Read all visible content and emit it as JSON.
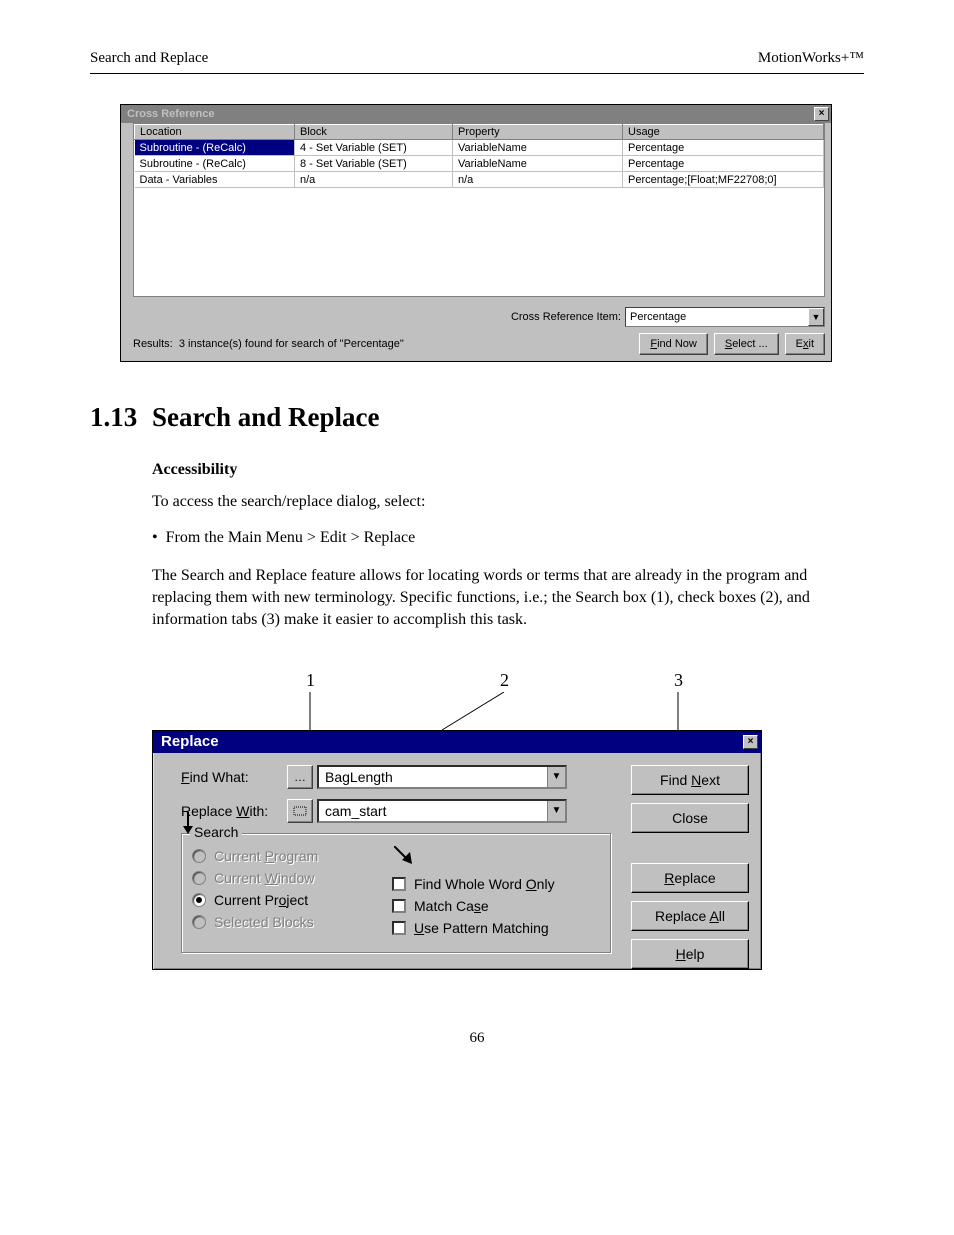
{
  "header": {
    "left": "Search and Replace",
    "right": "MotionWorks+™"
  },
  "crossref": {
    "title": "Cross Reference",
    "columns": [
      "Location",
      "Block",
      "Property",
      "Usage"
    ],
    "rows": [
      {
        "loc": "Subroutine - (ReCalc)",
        "block": "4 - Set Variable (SET)",
        "prop": "VariableName",
        "usage": "Percentage",
        "selected": true
      },
      {
        "loc": "Subroutine - (ReCalc)",
        "block": "8 - Set Variable (SET)",
        "prop": "VariableName",
        "usage": "Percentage"
      },
      {
        "loc": "Data - Variables",
        "block": "n/a",
        "prop": "n/a",
        "usage": "Percentage;[Float;MF22708;0]"
      }
    ],
    "cri_label": "Cross Reference Item:",
    "cri_value": "Percentage",
    "results_label": "Results:",
    "results_text": "3 instance(s) found for search of \"Percentage\"",
    "buttons": {
      "find": "Find Now",
      "select": "Select ...",
      "exit": "Exit"
    }
  },
  "section": {
    "number": "1.13",
    "title": "Search and Replace",
    "sub": "Accessibility",
    "p1": "To access the search/replace dialog, select:",
    "bullet": "From the Main Menu > Edit > Replace",
    "p2": "The Search and Replace feature allows for locating words or terms that are already in the program and replacing them with new terminology. Specific functions, i.e.; the Search box (1), check boxes (2), and  information tabs (3) make it easier to accomplish this task."
  },
  "callouts": {
    "c1": "1",
    "c2": "2",
    "c3": "3"
  },
  "replace": {
    "title": "Replace",
    "find_label": "Find What:",
    "find_value": "BagLength",
    "replace_label": "Replace With:",
    "replace_value": "cam_start",
    "group_title": "Search",
    "radios": {
      "program": "Current Program",
      "window": "Current Window",
      "project": "Current Project",
      "blocks": "Selected Blocks"
    },
    "checks": {
      "whole": "Find Whole Word Only",
      "case": "Match Case",
      "pattern": "Use Pattern Matching"
    },
    "buttons": {
      "findnext": "Find Next",
      "close": "Close",
      "replace": "Replace",
      "replaceall": "Replace All",
      "help": "Help"
    }
  },
  "page_number": "66"
}
